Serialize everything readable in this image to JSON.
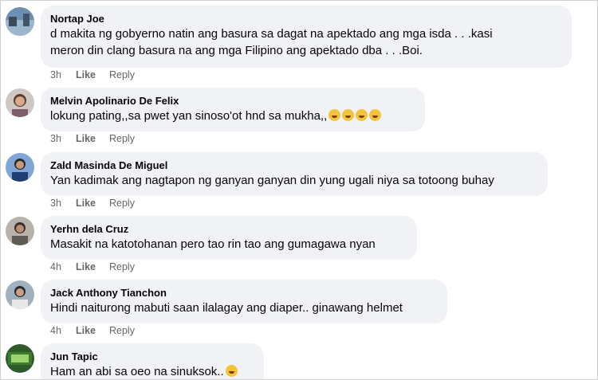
{
  "comments": [
    {
      "author": "Nortap Joe",
      "text_lines": [
        "d makita ng gobyerno natin ang basura sa dagat na apektado ang mga isda . . .kasi",
        "meron din clang basura na ang mga Filipino ang apektado dba . . .Boi."
      ],
      "time": "3h",
      "like": "Like",
      "reply": "Reply"
    },
    {
      "author": "Melvin Apolinario De Felix",
      "text_lines": [
        "lokung pating,,sa pwet yan sinoso'ot hnd sa mukha,,"
      ],
      "emoji_icons": [
        "rofl-emoji-icon",
        "rofl-emoji-icon",
        "rofl-emoji-icon",
        "rofl-emoji-icon"
      ],
      "time": "3h",
      "like": "Like",
      "reply": "Reply"
    },
    {
      "author": "Zald Masinda De Miguel",
      "text_lines": [
        "Yan kadimak ang nagtapon ng ganyan ganyan din yung ugali niya sa totoong buhay"
      ],
      "time": "3h",
      "like": "Like",
      "reply": "Reply"
    },
    {
      "author": "Yerhn dela Cruz",
      "text_lines": [
        "Masakit na katotohanan pero tao rin tao ang gumagawa nyan"
      ],
      "time": "4h",
      "like": "Like",
      "reply": "Reply"
    },
    {
      "author": "Jack Anthony Tianchon",
      "text_lines": [
        "Hindi naiturong mabuti saan ilalagay ang diaper.. ginawang helmet"
      ],
      "time": "4h",
      "like": "Like",
      "reply": "Reply"
    },
    {
      "author": "Jun Tapic",
      "text_lines": [
        "Ham an abi sa oeo na sinuksok.."
      ],
      "emoji_icons": [
        "grimace-emoji-icon"
      ],
      "time": "",
      "like": "",
      "reply": ""
    }
  ],
  "colors": {
    "bubble": "#f0f2f5",
    "meta": "#65676b",
    "text": "#050505"
  }
}
